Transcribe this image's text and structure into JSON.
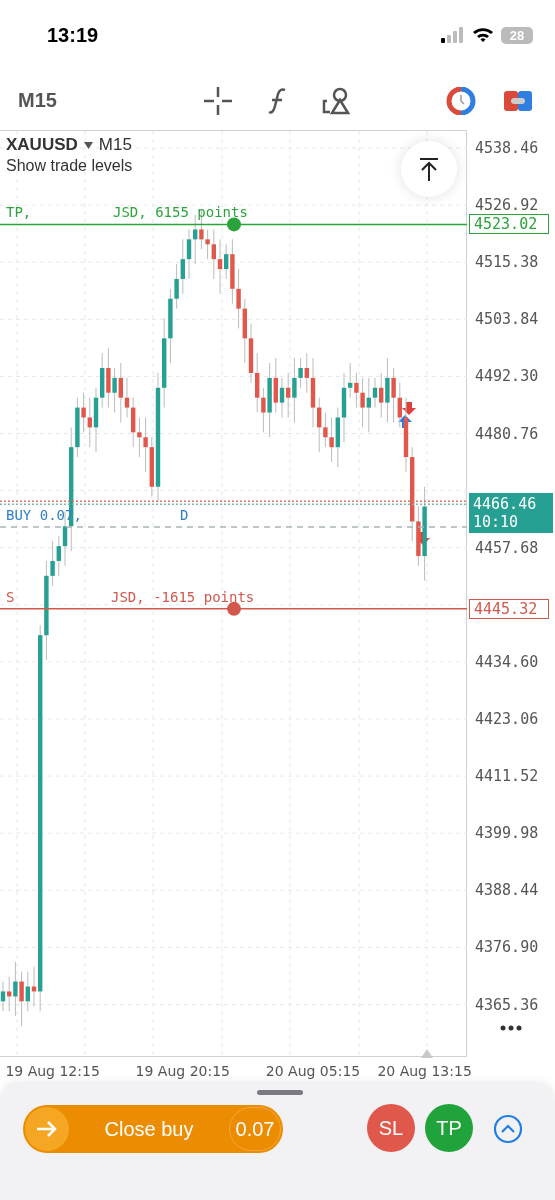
{
  "status_bar": {
    "time": "13:19",
    "battery": "28"
  },
  "toolbar": {
    "timeframe": "M15"
  },
  "chart": {
    "symbol": "XAUUSD",
    "timeframe": "M15",
    "subtitle": "Show trade levels",
    "levels": [
      {
        "kind": "tp",
        "label_start": "TP,",
        "label_end": "JSD, 6155 points",
        "price": "4523.02",
        "color": "#2aa33b"
      },
      {
        "kind": "entry",
        "label_start": "BUY 0.07,",
        "label_end": "D",
        "color": "#2f7fc8"
      },
      {
        "kind": "sl",
        "label_start": "S",
        "label_end": "JSD, -1615 points",
        "price": "4445.32",
        "color": "#d2584b"
      }
    ],
    "current_price": {
      "price": "4466.46",
      "countdown": "10:10"
    },
    "chart_data": {
      "type": "candlestick",
      "ylim": [
        4354.75,
        4542.1
      ],
      "grid": true,
      "yticks": [
        {
          "value": 4538.46,
          "label": "4538.46"
        },
        {
          "value": 4526.92,
          "label": "4526.92"
        },
        {
          "value": 4515.38,
          "label": "4515.38"
        },
        {
          "value": 4503.84,
          "label": "4503.84"
        },
        {
          "value": 4492.3,
          "label": "4492.30"
        },
        {
          "value": 4480.76,
          "label": "4480.76"
        },
        {
          "value": 4457.68,
          "label": "4457.68"
        },
        {
          "value": 4434.6,
          "label": "4434.60"
        },
        {
          "value": 4423.06,
          "label": "4423.06"
        },
        {
          "value": 4411.52,
          "label": "4411.52"
        },
        {
          "value": 4399.98,
          "label": "4399.98"
        },
        {
          "value": 4388.44,
          "label": "4388.44"
        },
        {
          "value": 4376.9,
          "label": "4376.90"
        },
        {
          "value": 4365.36,
          "label": "4365.36"
        }
      ],
      "categories": [
        null,
        null,
        null,
        null,
        null,
        null,
        null,
        null,
        "19 Aug 12:15",
        null,
        null,
        null,
        null,
        null,
        null,
        null,
        null,
        null,
        null,
        null,
        null,
        null,
        null,
        null,
        null,
        null,
        null,
        null,
        null,
        "19 Aug 20:15",
        null,
        null,
        null,
        null,
        null,
        null,
        null,
        null,
        null,
        null,
        null,
        null,
        null,
        null,
        null,
        null,
        null,
        null,
        null,
        null,
        "20 Aug 05:15",
        null,
        null,
        null,
        null,
        null,
        null,
        null,
        null,
        null,
        null,
        null,
        null,
        null,
        null,
        null,
        null,
        null,
        "20 Aug 13:15"
      ],
      "ohlc": [
        [
          4366,
          4370,
          4364,
          4368
        ],
        [
          4368,
          4371,
          4364,
          4367
        ],
        [
          4367,
          4374,
          4363,
          4370
        ],
        [
          4370,
          4372,
          4361,
          4366
        ],
        [
          4366,
          4372,
          4364,
          4369
        ],
        [
          4369,
          4373,
          4365,
          4368
        ],
        [
          4368,
          4442,
          4364,
          4440
        ],
        [
          4440,
          4455,
          4435,
          4452
        ],
        [
          4452,
          4459,
          4450,
          4455
        ],
        [
          4455,
          4460,
          4452,
          4458
        ],
        [
          4458,
          4465,
          4454,
          4462
        ],
        [
          4462,
          4482,
          4457,
          4478
        ],
        [
          4478,
          4488,
          4476,
          4486
        ],
        [
          4486,
          4489,
          4481,
          4484
        ],
        [
          4484,
          4488,
          4478,
          4482
        ],
        [
          4482,
          4490,
          4477,
          4488
        ],
        [
          4488,
          4497,
          4486,
          4494
        ],
        [
          4494,
          4498,
          4486,
          4489
        ],
        [
          4489,
          4494,
          4485,
          4492
        ],
        [
          4492,
          4495,
          4483,
          4488
        ],
        [
          4488,
          4492,
          4484,
          4486
        ],
        [
          4486,
          4488,
          4478,
          4481
        ],
        [
          4481,
          4484,
          4476,
          4480
        ],
        [
          4480,
          4484,
          4473,
          4478
        ],
        [
          4478,
          4480,
          4468,
          4470
        ],
        [
          4470,
          4493,
          4467,
          4490
        ],
        [
          4490,
          4504,
          4486,
          4500
        ],
        [
          4500,
          4510,
          4495,
          4508
        ],
        [
          4508,
          4515,
          4506,
          4512
        ],
        [
          4512,
          4520,
          4509,
          4516
        ],
        [
          4516,
          4522,
          4512,
          4520
        ],
        [
          4520,
          4525,
          4515,
          4522
        ],
        [
          4522,
          4526,
          4518,
          4520
        ],
        [
          4520,
          4522,
          4516,
          4519
        ],
        [
          4519,
          4522,
          4512,
          4516
        ],
        [
          4516,
          4520,
          4509,
          4514
        ],
        [
          4514,
          4519,
          4512,
          4517
        ],
        [
          4517,
          4520,
          4507,
          4510
        ],
        [
          4510,
          4514,
          4502,
          4506
        ],
        [
          4506,
          4508,
          4495,
          4500
        ],
        [
          4500,
          4503,
          4491,
          4493
        ],
        [
          4493,
          4497,
          4485,
          4488
        ],
        [
          4488,
          4490,
          4481,
          4485
        ],
        [
          4485,
          4495,
          4480,
          4492
        ],
        [
          4492,
          4496,
          4485,
          4487
        ],
        [
          4487,
          4492,
          4484,
          4490
        ],
        [
          4490,
          4493,
          4484,
          4488
        ],
        [
          4488,
          4496,
          4483,
          4492
        ],
        [
          4492,
          4496,
          4490,
          4494
        ],
        [
          4494,
          4497,
          4489,
          4492
        ],
        [
          4492,
          4496,
          4482,
          4486
        ],
        [
          4486,
          4488,
          4477,
          4482
        ],
        [
          4482,
          4485,
          4478,
          4480
        ],
        [
          4480,
          4484,
          4475,
          4478
        ],
        [
          4478,
          4486,
          4474,
          4484
        ],
        [
          4484,
          4493,
          4479,
          4490
        ],
        [
          4490,
          4495,
          4488,
          4491
        ],
        [
          4491,
          4493,
          4486,
          4489
        ],
        [
          4489,
          4492,
          4482,
          4486
        ],
        [
          4486,
          4492,
          4481,
          4488
        ],
        [
          4488,
          4492,
          4486,
          4490
        ],
        [
          4490,
          4493,
          4484,
          4487
        ],
        [
          4487,
          4496,
          4483,
          4492
        ],
        [
          4492,
          4494,
          4483,
          4488
        ],
        [
          4488,
          4491,
          4482,
          4484
        ],
        [
          4484,
          4488,
          4473,
          4476
        ],
        [
          4476,
          4478,
          4459,
          4463
        ],
        [
          4463,
          4466,
          4454,
          4456
        ],
        [
          4456,
          4470,
          4451,
          4466
        ]
      ]
    }
  },
  "trade_panel": {
    "close_button": "Close buy",
    "volume": "0.07",
    "sl": "SL",
    "tp": "TP"
  }
}
